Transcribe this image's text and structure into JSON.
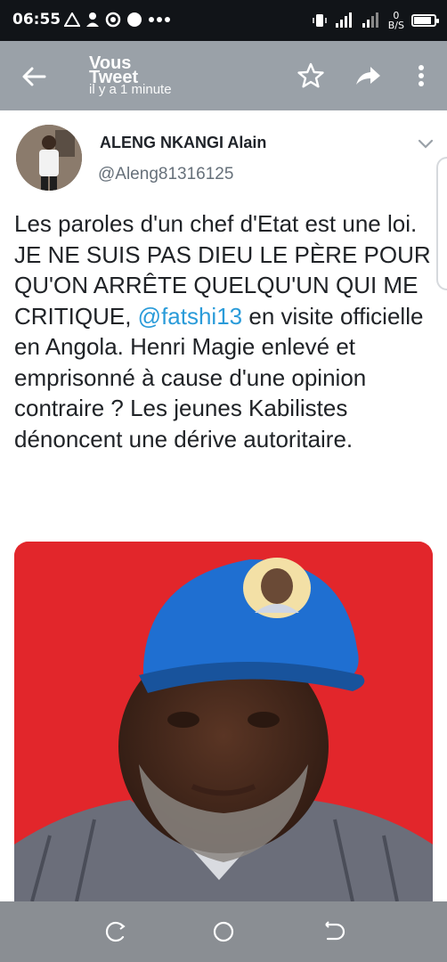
{
  "status_bar": {
    "time": "06:55",
    "left_icons": [
      "warning-triangle-icon",
      "person-icon",
      "wifi-calling-icon",
      "circle-icon",
      "more-dots-icon"
    ],
    "speed_value": "0",
    "speed_unit": "B/S",
    "battery_level": 0.85
  },
  "header": {
    "title_1": "Vous",
    "title_2": "Tweet",
    "subtitle": "il y a 1 minute",
    "icons": [
      "back-arrow-icon",
      "star-icon",
      "share-icon",
      "more-vert-icon"
    ]
  },
  "tweet": {
    "author_name": "ALENG NKANGI Alain",
    "author_handle": "@Aleng81316125",
    "text_before_mention": "Les paroles d'un chef d'Etat est une loi. JE NE SUIS PAS DIEU LE PÈRE POUR QU'ON ARRÊTE QUELQU'UN QUI ME CRITIQUE, ",
    "mention": "@fatshi13",
    "text_after_mention": " en visite officielle en Angola. Henri Magie enlevé et emprisonné à cause d'une opinion contraire ? Les jeunes Kabilistes dénoncent une dérive autoritaire."
  },
  "colors": {
    "status_bar_bg": "#111418",
    "header_bg": "#9aa1a8",
    "mention": "#2a9bd9",
    "photo_bg": "#e2262b",
    "cap_blue": "#1f6fd1",
    "nav_bar_bg": "#8a8e93"
  },
  "nav_bar": {
    "icons": [
      "recent-apps-icon",
      "home-icon",
      "back-icon"
    ]
  }
}
